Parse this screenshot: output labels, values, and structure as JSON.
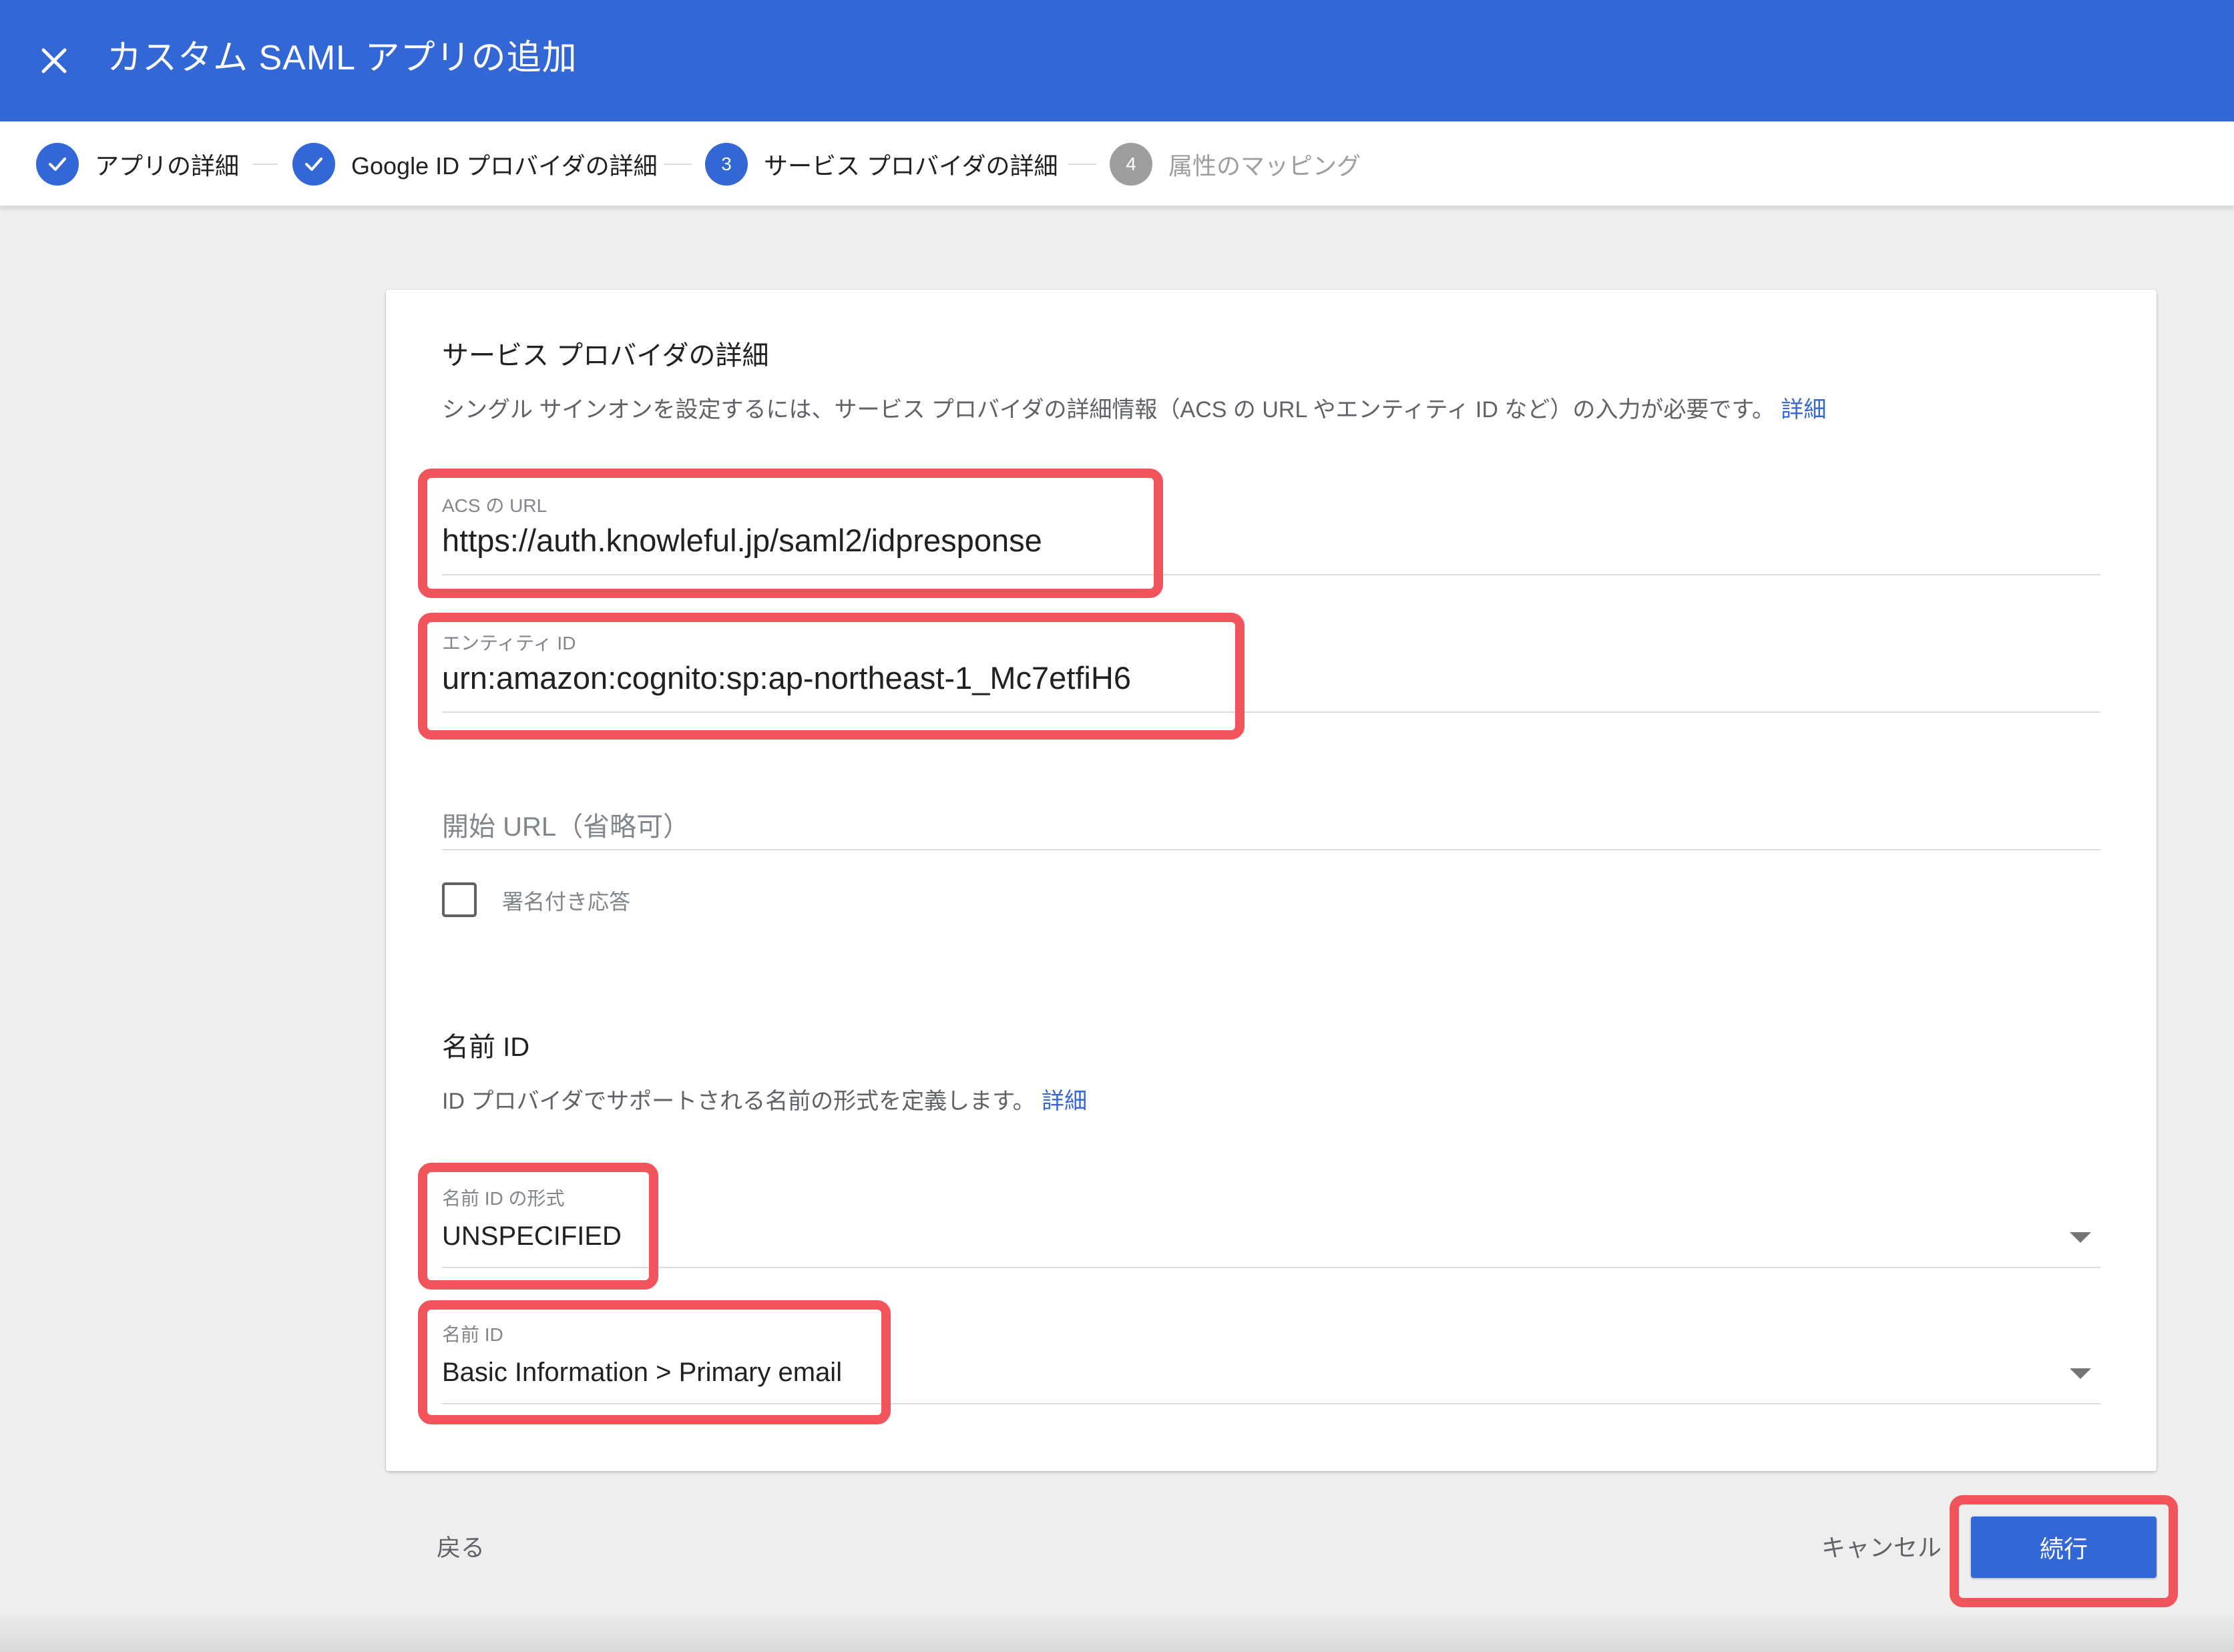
{
  "header": {
    "title": "カスタム SAML アプリの追加",
    "close_icon": "close-icon"
  },
  "stepper": {
    "steps": [
      {
        "label": "アプリの詳細",
        "state": "done"
      },
      {
        "label": "Google ID プロバイダの詳細",
        "state": "done"
      },
      {
        "number": "3",
        "label": "サービス プロバイダの詳細",
        "state": "active"
      },
      {
        "number": "4",
        "label": "属性のマッピング",
        "state": "pending"
      }
    ]
  },
  "service_provider": {
    "title": "サービス プロバイダの詳細",
    "description": "シングル サインオンを設定するには、サービス プロバイダの詳細情報（ACS の URL やエンティティ ID など）の入力が必要です。",
    "learn_more": "詳細",
    "acs_url": {
      "label": "ACS の URL",
      "value": "https://auth.knowleful.jp/saml2/idpresponse"
    },
    "entity_id": {
      "label": "エンティティ ID",
      "value": "urn:amazon:cognito:sp:ap-northeast-1_Mc7etfiH6"
    },
    "start_url": {
      "placeholder": "開始 URL（省略可）"
    },
    "signed_response": {
      "label": "署名付き応答",
      "checked": false
    }
  },
  "name_id": {
    "title": "名前 ID",
    "description": "ID プロバイダでサポートされる名前の形式を定義します。",
    "learn_more": "詳細",
    "format": {
      "label": "名前 ID の形式",
      "value": "UNSPECIFIED"
    },
    "name_id": {
      "label": "名前 ID",
      "value": "Basic Information > Primary email"
    }
  },
  "footer": {
    "back": "戻る",
    "cancel": "キャンセル",
    "continue": "続行"
  },
  "colors": {
    "primary": "#3367d6",
    "highlight": "#f2545b"
  }
}
